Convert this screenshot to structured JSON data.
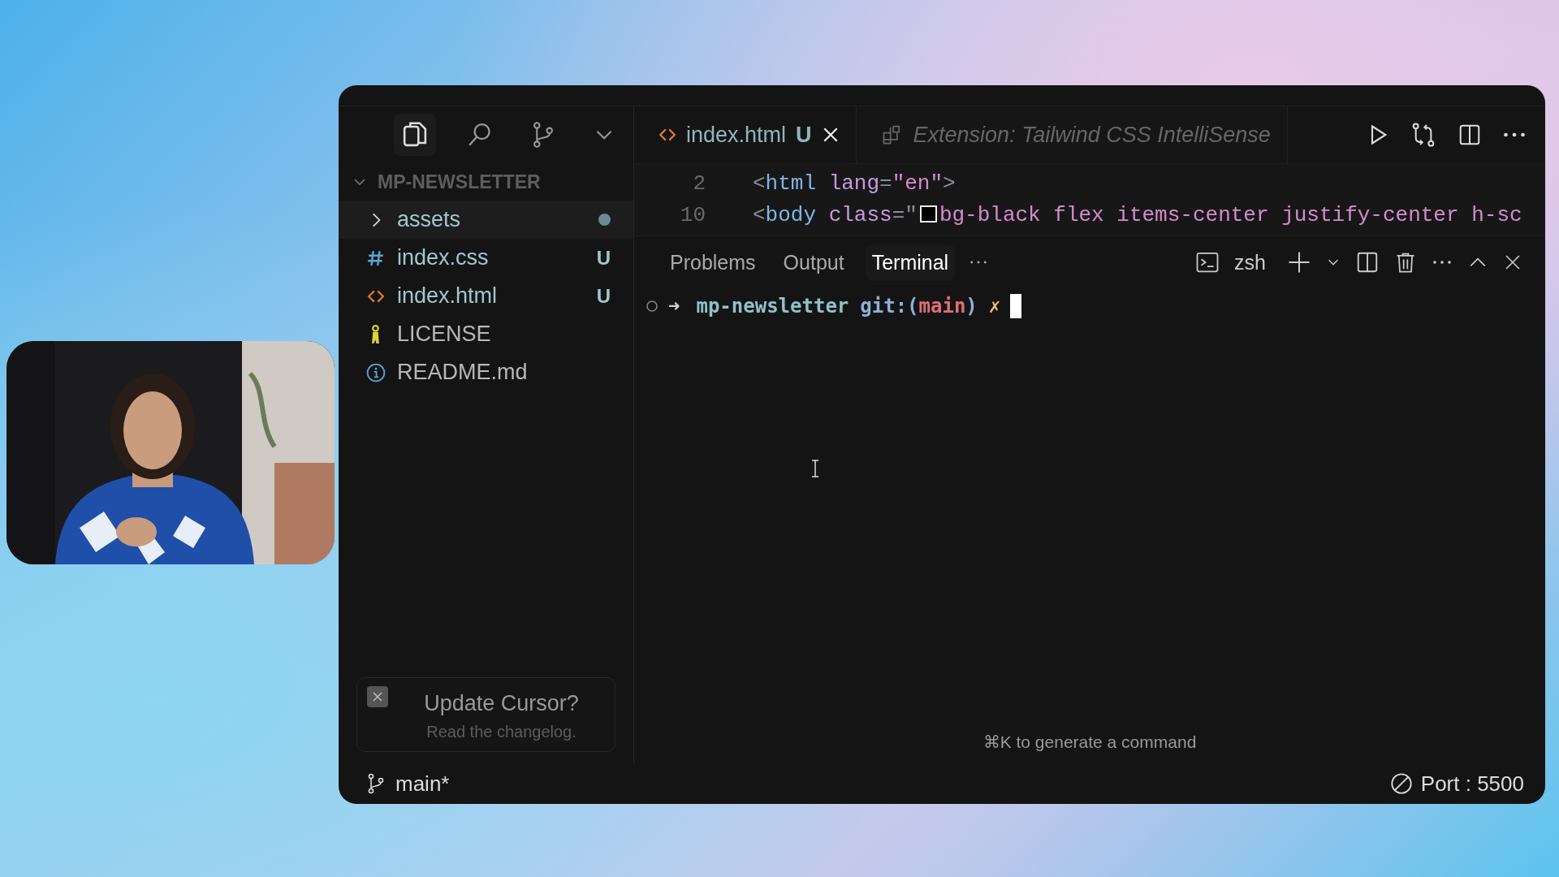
{
  "explorer": {
    "project": "MP-NEWSLETTER",
    "expanded": true,
    "items": [
      {
        "kind": "folder",
        "name": "assets",
        "selected": true,
        "modified_dot": true
      },
      {
        "kind": "css",
        "name": "index.css",
        "selected": false,
        "badge": "U"
      },
      {
        "kind": "html",
        "name": "index.html",
        "selected": false,
        "badge": "U"
      },
      {
        "kind": "license",
        "name": "LICENSE",
        "selected": false
      },
      {
        "kind": "info",
        "name": "README.md",
        "selected": false
      }
    ]
  },
  "editor_tabs": [
    {
      "kind": "html",
      "label": "index.html",
      "badge": "U",
      "selected": true,
      "preview": false
    },
    {
      "kind": "extension",
      "label": "Extension: Tailwind CSS IntelliSense",
      "selected": false,
      "preview": true
    }
  ],
  "code_lines": [
    {
      "number": "2",
      "tokens": [
        {
          "kind": "punct",
          "text": "<"
        },
        {
          "kind": "tag",
          "text": "html"
        },
        {
          "kind": "attr",
          "text": " lang"
        },
        {
          "kind": "punct",
          "text": "="
        },
        {
          "kind": "string",
          "text": "\"en\""
        },
        {
          "kind": "punct",
          "text": ">"
        }
      ]
    },
    {
      "number": "10",
      "tokens": [
        {
          "kind": "punct",
          "text": "<"
        },
        {
          "kind": "tag",
          "text": "body"
        },
        {
          "kind": "attr",
          "text": " class"
        },
        {
          "kind": "punct",
          "text": "=\""
        },
        {
          "kind": "swatch",
          "color": "#000000"
        },
        {
          "kind": "string",
          "text": "bg-black flex items-center justify-center h-sc"
        }
      ]
    }
  ],
  "panel_tabs": [
    {
      "label": "Problems",
      "selected": false
    },
    {
      "label": "Output",
      "selected": false
    },
    {
      "label": "Terminal",
      "selected": true
    }
  ],
  "terminal": {
    "shell": "zsh",
    "prompt": [
      {
        "kind": "arrow",
        "text": "➜"
      },
      {
        "kind": "dir",
        "text": "mp-newsletter"
      },
      {
        "kind": "git",
        "text": "git:("
      },
      {
        "kind": "branch",
        "text": "main"
      },
      {
        "kind": "git",
        "text": ")"
      },
      {
        "kind": "dirty",
        "text": "✗"
      }
    ],
    "hint": "⌘K to generate a command"
  },
  "notification": {
    "title": "Update Cursor?",
    "body": "Read the changelog."
  },
  "status_bar": {
    "branch": "main*",
    "port": "Port : 5500"
  }
}
